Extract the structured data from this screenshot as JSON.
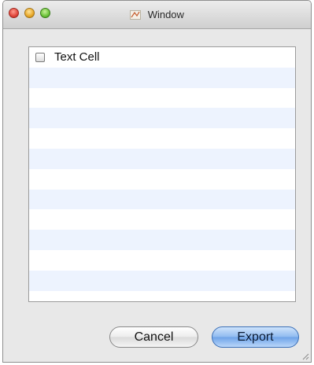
{
  "window": {
    "title": "Window"
  },
  "table": {
    "rows": [
      {
        "label": "Text Cell",
        "checked": false
      },
      {
        "label": ""
      },
      {
        "label": ""
      },
      {
        "label": ""
      },
      {
        "label": ""
      },
      {
        "label": ""
      },
      {
        "label": ""
      },
      {
        "label": ""
      },
      {
        "label": ""
      },
      {
        "label": ""
      },
      {
        "label": ""
      },
      {
        "label": ""
      }
    ]
  },
  "buttons": {
    "cancel_label": "Cancel",
    "export_label": "Export"
  },
  "icons": {
    "app": "app-icon",
    "resize": "resize-grip-icon"
  },
  "colors": {
    "row_alt": "#edf3fe",
    "export_accent": "#8fbaf0"
  }
}
